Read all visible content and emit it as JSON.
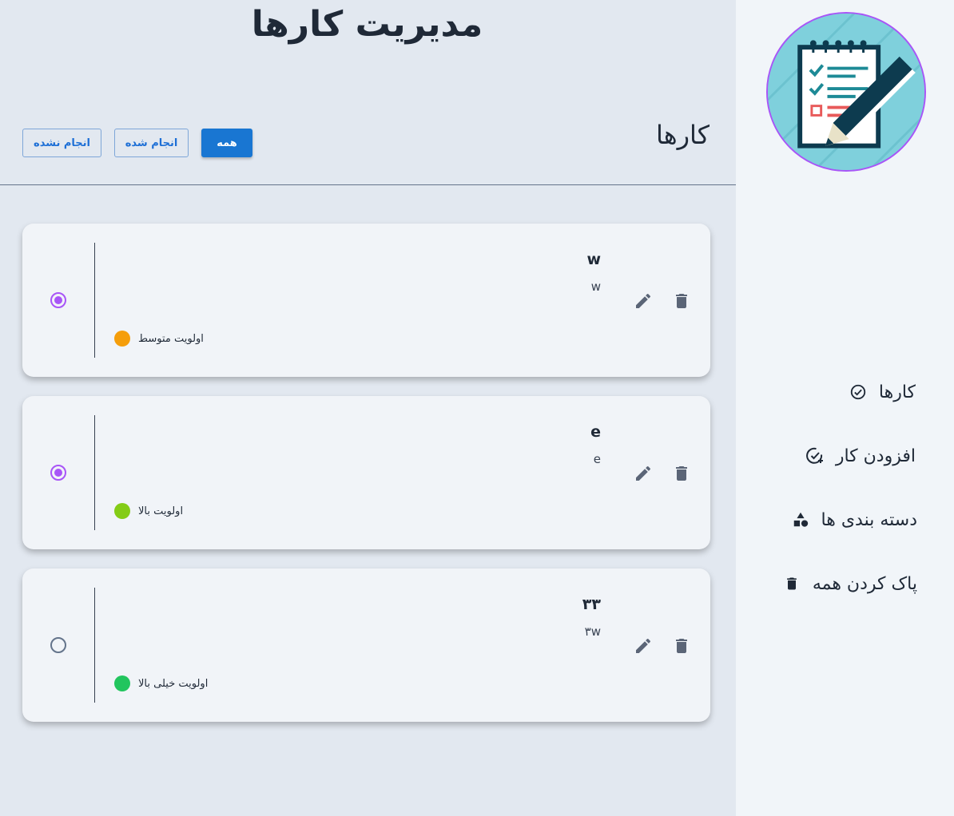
{
  "header": {
    "title": "مدیریت کارها"
  },
  "section": {
    "title": "کارها"
  },
  "filters": {
    "all": "همه",
    "done": "انجام شده",
    "not_done": "انجام نشده"
  },
  "sidebar": {
    "items": [
      {
        "label": "کارها",
        "icon": "check-circle-icon"
      },
      {
        "label": "افزودن کار",
        "icon": "add-task-icon"
      },
      {
        "label": "دسته بندی ها",
        "icon": "shapes-icon"
      },
      {
        "label": "پاک کردن همه",
        "icon": "trash-icon"
      }
    ]
  },
  "tasks": [
    {
      "title": "w",
      "desc": "w",
      "priority": "اولویت متوسط",
      "priority_color": "#f59e0b",
      "done": true
    },
    {
      "title": "e",
      "desc": "e",
      "priority": "اولویت بالا",
      "priority_color": "#84cc16",
      "done": true
    },
    {
      "title": "۳۳",
      "desc": "۳w",
      "priority": "اولویت خیلی بالا",
      "priority_color": "#22c55e",
      "done": false
    }
  ],
  "colors": {
    "accent": "#a855f7",
    "primary": "#1976d2"
  }
}
